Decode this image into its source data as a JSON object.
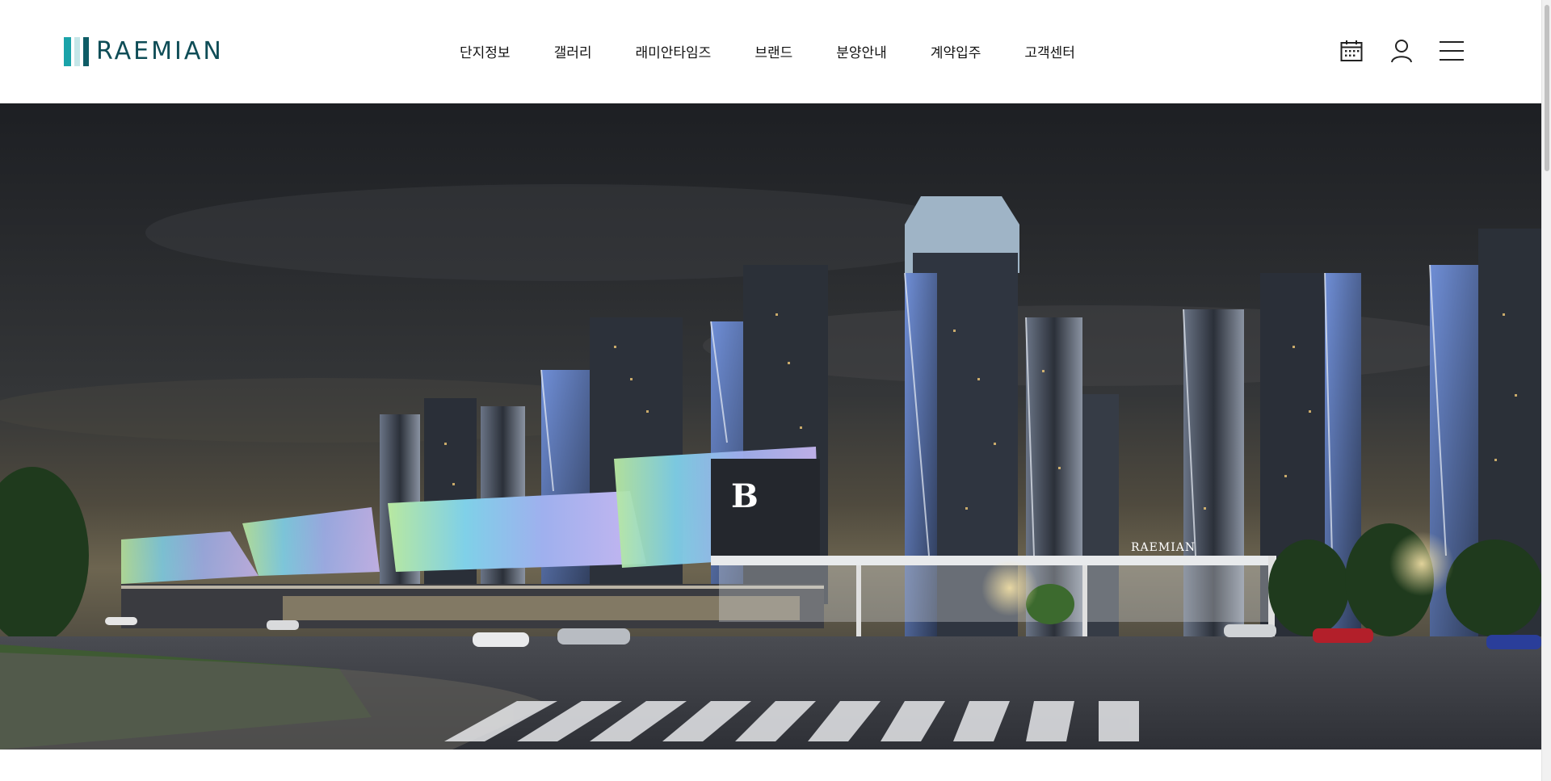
{
  "brand": {
    "name": "RAEMIAN",
    "colors": {
      "teal": "#1aa3a9",
      "dark_teal": "#0f4d57"
    }
  },
  "nav": {
    "items": [
      {
        "label": "단지정보"
      },
      {
        "label": "갤러리"
      },
      {
        "label": "래미안타임즈"
      },
      {
        "label": "브랜드"
      },
      {
        "label": "분양안내"
      },
      {
        "label": "계약입주"
      },
      {
        "label": "고객센터"
      }
    ]
  },
  "utilities": {
    "calendar_icon": "calendar-icon",
    "user_icon": "user-icon",
    "menu_icon": "hamburger-menu-icon"
  },
  "hero": {
    "building_sign": "RAEMIAN",
    "mall_logo": "B"
  }
}
